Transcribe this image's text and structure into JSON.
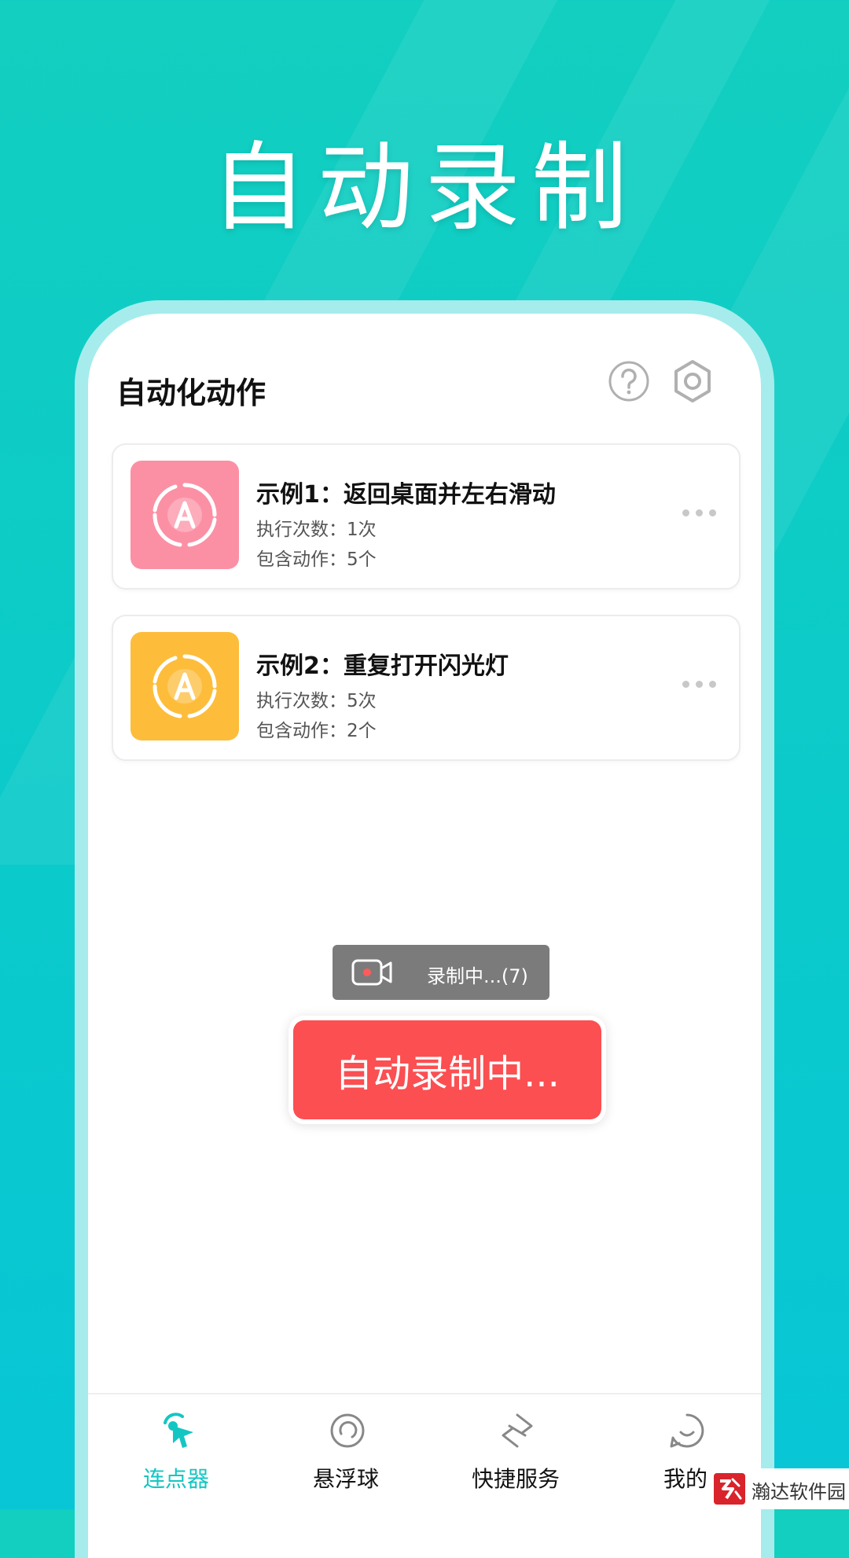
{
  "hero": {
    "title": "自动录制"
  },
  "app": {
    "title": "自动化动作"
  },
  "header_icons": {
    "help": "question-circle-icon",
    "settings": "gear-icon"
  },
  "items": [
    {
      "title": "示例1：返回桌面并左右滑动",
      "exec": "执行次数：1次",
      "actions": "包含动作：5个",
      "thumb_color": "#fb90a4",
      "icon": "auto-a-icon"
    },
    {
      "title": "示例2：重复打开闪光灯",
      "exec": "执行次数：5次",
      "actions": "包含动作：2个",
      "thumb_color": "#fdbd3b",
      "icon": "auto-a-icon"
    }
  ],
  "toast": {
    "text": "录制中...(7)",
    "icon": "video-record-icon"
  },
  "record_button": {
    "label": "自动录制中..."
  },
  "tabs": [
    {
      "label": "连点器",
      "icon": "cursor-click-icon",
      "active": true
    },
    {
      "label": "悬浮球",
      "icon": "float-ball-icon",
      "active": false
    },
    {
      "label": "快捷服务",
      "icon": "shortcut-icon",
      "active": false
    },
    {
      "label": "我的",
      "icon": "profile-icon",
      "active": false
    }
  ],
  "watermark": {
    "text": "瀚达软件园"
  },
  "colors": {
    "accent": "#14c6c3",
    "record": "#fb4f52",
    "toast_bg": "#7b7b7b",
    "background": "#0ccbc8"
  }
}
